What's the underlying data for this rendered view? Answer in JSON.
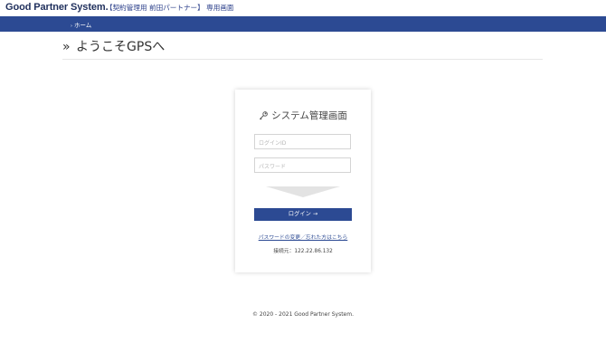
{
  "header": {
    "logo": "Good Partner System",
    "subtitle": "【契約管理用 前田パートナー】 専用画面"
  },
  "nav": {
    "breadcrumb": "ホーム"
  },
  "page": {
    "title": "ようこそGPSへ"
  },
  "login": {
    "title": "システム管理画面",
    "login_id_placeholder": "ログインID",
    "password_placeholder": "パスワード",
    "submit_label": "ログイン →",
    "password_link": "パスワードの変更／忘れた方はこちら",
    "connection_info": "接続元：122.22.86.132"
  },
  "footer": {
    "copyright": "© 2020 - 2021 Good Partner System."
  },
  "colors": {
    "brand": "#2c4a93",
    "logo": "#1f2f5c"
  }
}
